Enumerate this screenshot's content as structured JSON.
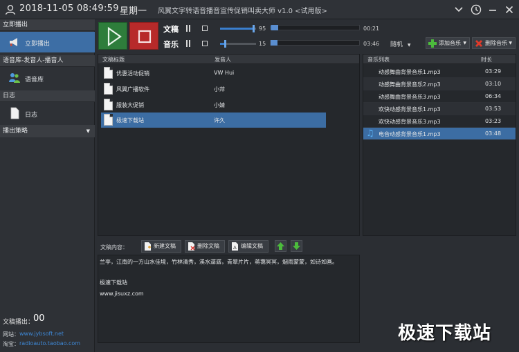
{
  "titlebar": {
    "datetime": "2018-11-05 08:49:59",
    "weekday": "星期一",
    "app_title": "风翼文字转语音播音宣传促销叫卖大师 v1.0 <试用版>"
  },
  "sidebar": {
    "section_broadcast": "立即播出",
    "item_broadcast": "立即播出",
    "section_library": "语音库-发音人-播音人",
    "item_library": "语音库",
    "section_log": "日志",
    "item_log": "日志",
    "strategy": "播出策略",
    "count_label": "文稿播出：",
    "count_value": "00",
    "website_label": "网站：",
    "website_value": "www.jybsoft.net",
    "taobao_label": "淘宝：",
    "taobao_value": "radioauto.taobao.com"
  },
  "controls": {
    "script_label": "文稿",
    "music_label": "音乐",
    "script_volume": "95",
    "music_volume": "15",
    "script_time": "00:21",
    "music_time": "03:46",
    "script_volume_fraction": 0.95,
    "music_volume_fraction": 0.15,
    "script_progress_fraction": 0.05,
    "music_progress_fraction": 0.02,
    "play_mode": "随机",
    "add_music": "添加音乐",
    "delete_music": "删除音乐",
    "colors": {
      "play": "#2e7d3b",
      "stop": "#b72a2a",
      "accent": "#3c6da3"
    }
  },
  "script_list": {
    "col_title": "文稿标题",
    "col_speaker": "发音人",
    "rows": [
      {
        "title": "优惠活动促销",
        "speaker": "VW Hui"
      },
      {
        "title": "风翼广播软件",
        "speaker": "小萍"
      },
      {
        "title": "服装大促销",
        "speaker": "小婧"
      },
      {
        "title": "极速下载站",
        "speaker": "许久"
      }
    ],
    "selected_index": 3
  },
  "music_list": {
    "col_name": "音乐列表",
    "col_duration": "时长",
    "rows": [
      {
        "name": "动感舞曲背景音乐1.mp3",
        "duration": "03:29"
      },
      {
        "name": "动感舞曲背景音乐2.mp3",
        "duration": "03:10"
      },
      {
        "name": "动感舞曲背景音乐3.mp3",
        "duration": "06:34"
      },
      {
        "name": "欢快动感背景音乐1.mp3",
        "duration": "03:53"
      },
      {
        "name": "欢快动感背景音乐3.mp3",
        "duration": "03:23"
      },
      {
        "name": "电音动感背景音乐1.mp3",
        "duration": "03:48"
      }
    ],
    "selected_index": 5
  },
  "editor": {
    "content_label": "文稿内容：",
    "new_btn": "新建文稿",
    "delete_btn": "删除文稿",
    "edit_btn": "编辑文稿",
    "lines": [
      "兰亭，江南的一方山水佳境，竹林清秀，溪水潺潺，青翠片片，蒋霭冥冥，烟雨蒙蒙，如诗如画。",
      "",
      "极速下载站",
      "www.jisuxz.com"
    ]
  },
  "watermark": "极速下载站"
}
